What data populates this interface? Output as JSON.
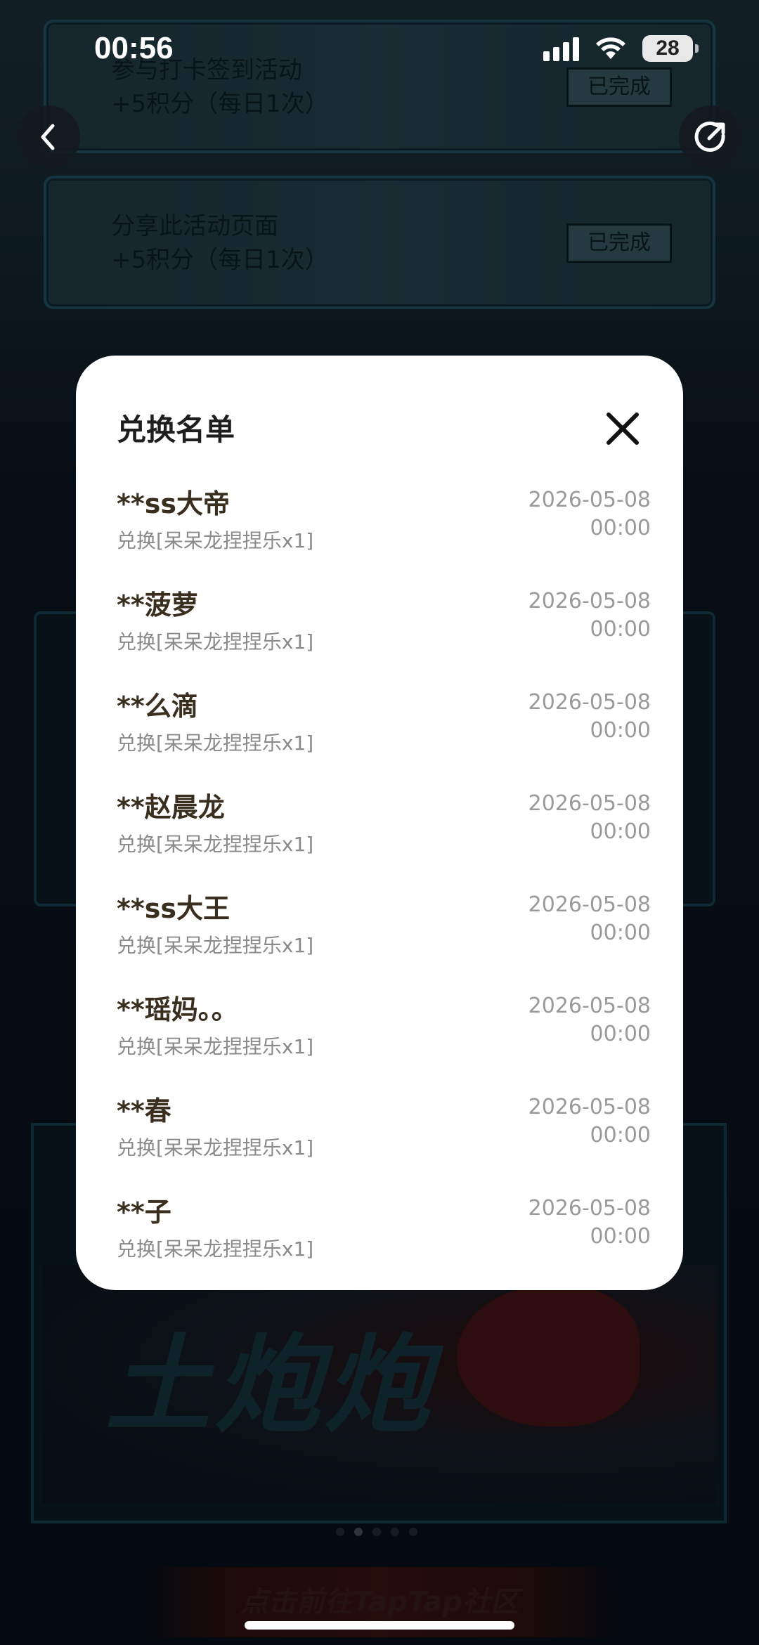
{
  "status_bar": {
    "time": "00:56",
    "battery": "28"
  },
  "background": {
    "tasks": [
      {
        "line1": "参与打卡签到活动",
        "line2": "+5积分（每日1次）",
        "button": "已完成"
      },
      {
        "line1": "分享此活动页面",
        "line2": "+5积分（每日1次）",
        "button": "已完成"
      }
    ],
    "banner_text": "土炮炮",
    "cta_text": "点击前往TapTap社区",
    "page_dots": 5,
    "active_dot": 1
  },
  "modal": {
    "title": "兑换名单",
    "records": [
      {
        "name": "**ss大帝",
        "desc": "兑换[呆呆龙捏捏乐x1]",
        "date": "2026-05-08",
        "time": "00:00"
      },
      {
        "name": "**菠萝",
        "desc": "兑换[呆呆龙捏捏乐x1]",
        "date": "2026-05-08",
        "time": "00:00"
      },
      {
        "name": "**么滴",
        "desc": "兑换[呆呆龙捏捏乐x1]",
        "date": "2026-05-08",
        "time": "00:00"
      },
      {
        "name": "**赵晨龙",
        "desc": "兑换[呆呆龙捏捏乐x1]",
        "date": "2026-05-08",
        "time": "00:00"
      },
      {
        "name": "**ss大王",
        "desc": "兑换[呆呆龙捏捏乐x1]",
        "date": "2026-05-08",
        "time": "00:00"
      },
      {
        "name": "**瑶妈。。",
        "desc": "兑换[呆呆龙捏捏乐x1]",
        "date": "2026-05-08",
        "time": "00:00"
      },
      {
        "name": "**春",
        "desc": "兑换[呆呆龙捏捏乐x1]",
        "date": "2026-05-08",
        "time": "00:00"
      },
      {
        "name": "**子",
        "desc": "兑换[呆呆龙捏捏乐x1]",
        "date": "2026-05-08",
        "time": "00:00"
      }
    ]
  },
  "colors": {
    "modal_bg": "#ffffff",
    "name_text": "#3a2e1e",
    "muted_text": "#8a8a8a",
    "overlay": "rgba(0,0,0,0.5)"
  }
}
